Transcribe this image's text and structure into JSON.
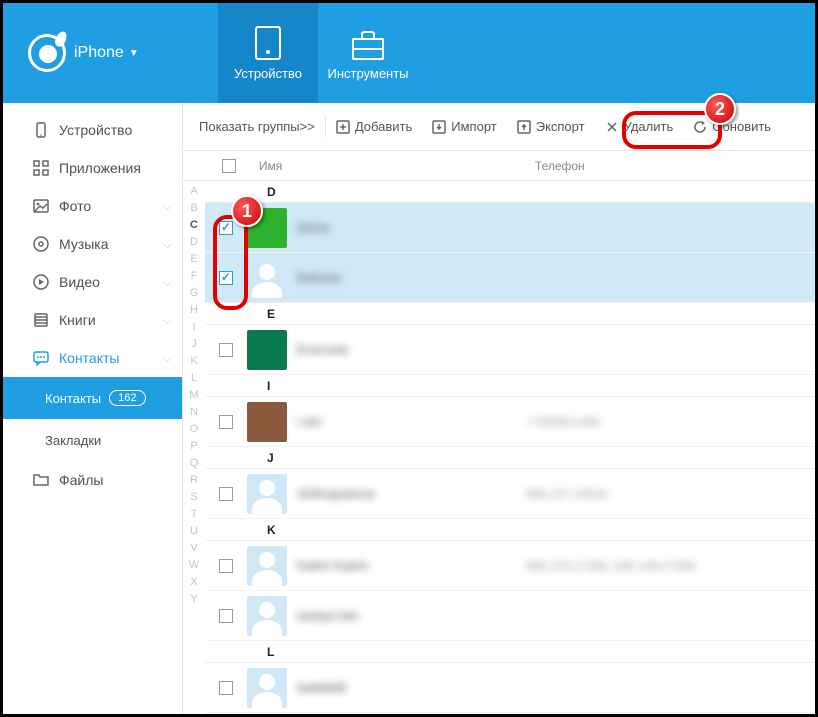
{
  "brand": {
    "name": "iPhone"
  },
  "header_tabs": {
    "device": "Устройство",
    "tools": "Инструменты"
  },
  "sidebar": {
    "device": "Устройство",
    "apps": "Приложения",
    "photo": "Фото",
    "music": "Музыка",
    "video": "Видео",
    "books": "Книги",
    "contacts": "Контакты",
    "files": "Файлы",
    "sub_contacts": "Контакты",
    "sub_bookmarks": "Закладки",
    "contacts_count": "162"
  },
  "toolbar": {
    "show_groups": "Показать группы>>",
    "add": "Добавить",
    "import": "Импорт",
    "export": "Экспорт",
    "delete": "Удалить",
    "refresh": "Обновить"
  },
  "columns": {
    "name": "Имя",
    "phone": "Телефон"
  },
  "alpha_index": [
    "A",
    "B",
    "C",
    "D",
    "E",
    "F",
    "G",
    "H",
    "I",
    "J",
    "K",
    "L",
    "M",
    "N",
    "O",
    "P",
    "Q",
    "R",
    "S",
    "T",
    "U",
    "V",
    "W",
    "X",
    "Y"
  ],
  "active_letters": [
    "D",
    "E",
    "I",
    "J",
    "K",
    "L"
  ],
  "sections": [
    {
      "letter": "D",
      "contacts": [
        {
          "name": "Denis",
          "phone": "",
          "checked": true,
          "avatar": "green",
          "selected": true
        },
        {
          "name": "Defuser",
          "phone": "",
          "checked": true,
          "avatar": "placeholder",
          "selected": true
        }
      ]
    },
    {
      "letter": "E",
      "contacts": [
        {
          "name": "Evernote",
          "phone": "",
          "checked": false,
          "avatar": "dark"
        }
      ]
    },
    {
      "letter": "I",
      "contacts": [
        {
          "name": "I am",
          "phone": "+7953621465",
          "checked": false,
          "avatar": "brown"
        }
      ]
    },
    {
      "letter": "J",
      "contacts": [
        {
          "name": "JshKapukova",
          "phone": "885-227-20044",
          "checked": false,
          "avatar": "placeholder"
        }
      ]
    },
    {
      "letter": "K",
      "contacts": [
        {
          "name": "Katrin Katrin",
          "phone": "895-376-27485, 845-108-27585",
          "checked": false,
          "avatar": "placeholder"
        },
        {
          "name": "nastya lolo",
          "phone": "",
          "checked": false,
          "avatar": "placeholder"
        }
      ]
    },
    {
      "letter": "L",
      "contacts": [
        {
          "name": "ludddddl",
          "phone": "",
          "checked": false,
          "avatar": "placeholder"
        }
      ]
    }
  ],
  "annotations": {
    "marker1": "1",
    "marker2": "2"
  }
}
